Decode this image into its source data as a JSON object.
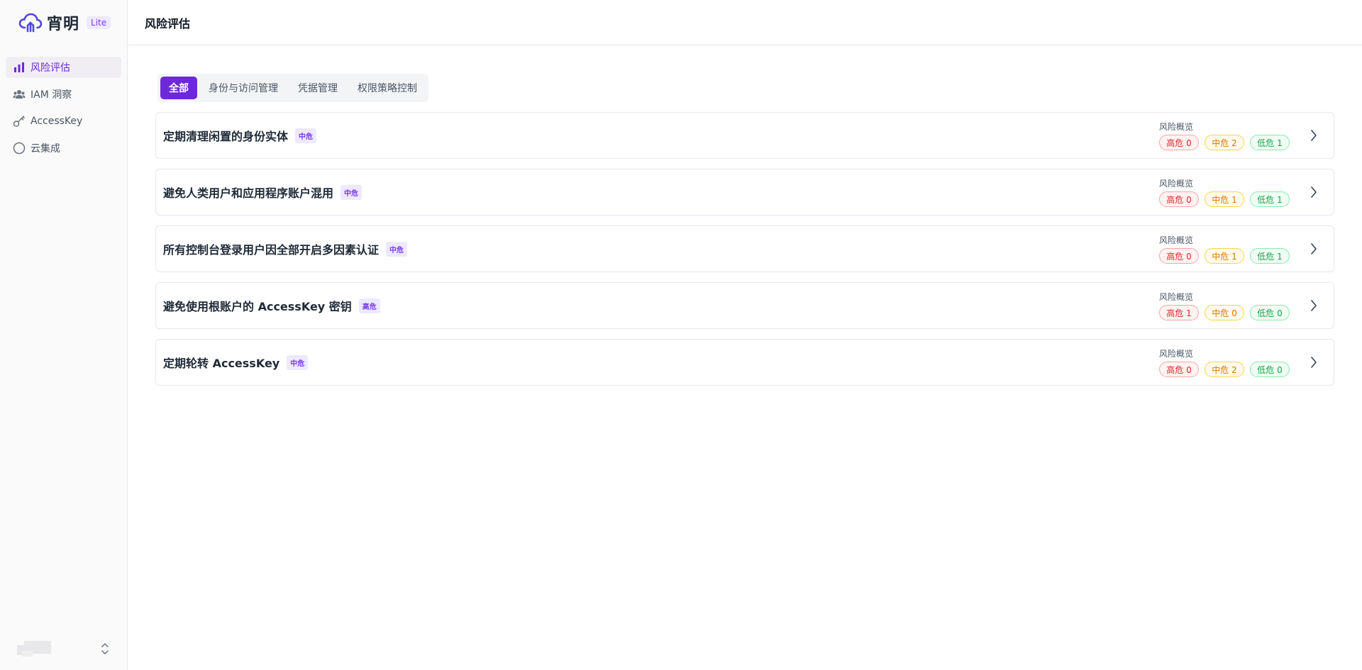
{
  "sidebar": {
    "logo_text": "宵明",
    "logo_badge": "Lite",
    "items": [
      {
        "label": "风险评估",
        "icon": "bar-chart-icon",
        "active": true
      },
      {
        "label": "IAM 洞察",
        "icon": "users-icon",
        "active": false
      },
      {
        "label": "AccessKey",
        "icon": "key-icon",
        "active": false
      },
      {
        "label": "云集成",
        "icon": "circle-icon",
        "active": false
      }
    ]
  },
  "header": {
    "title": "风险评估"
  },
  "tabs": [
    {
      "label": "全部",
      "active": true
    },
    {
      "label": "身份与访问管理",
      "active": false
    },
    {
      "label": "凭据管理",
      "active": false
    },
    {
      "label": "权限策略控制",
      "active": false
    }
  ],
  "risks": [
    {
      "title": "定期清理闲置的身份实体",
      "level": "中危",
      "overview_label": "风险概览",
      "high": "高危 0",
      "mid": "中危 2",
      "low": "低危 1"
    },
    {
      "title": "避免人类用户和应用程序账户混用",
      "level": "中危",
      "overview_label": "风险概览",
      "high": "高危 0",
      "mid": "中危 1",
      "low": "低危 1"
    },
    {
      "title": "所有控制台登录用户因全部开启多因素认证",
      "level": "中危",
      "overview_label": "风险概览",
      "high": "高危 0",
      "mid": "中危 1",
      "low": "低危 1"
    },
    {
      "title": "避免使用根账户的 AccessKey 密钥",
      "level": "高危",
      "overview_label": "风险概览",
      "high": "高危 1",
      "mid": "中危 0",
      "low": "低危 0"
    },
    {
      "title": "定期轮转 AccessKey",
      "level": "中危",
      "overview_label": "风险概览",
      "high": "高危 0",
      "mid": "中危 2",
      "low": "低危 0"
    }
  ],
  "colors": {
    "accent": "#6d28d9",
    "high": "#dc2626",
    "mid": "#d97706",
    "low": "#16a34a"
  }
}
